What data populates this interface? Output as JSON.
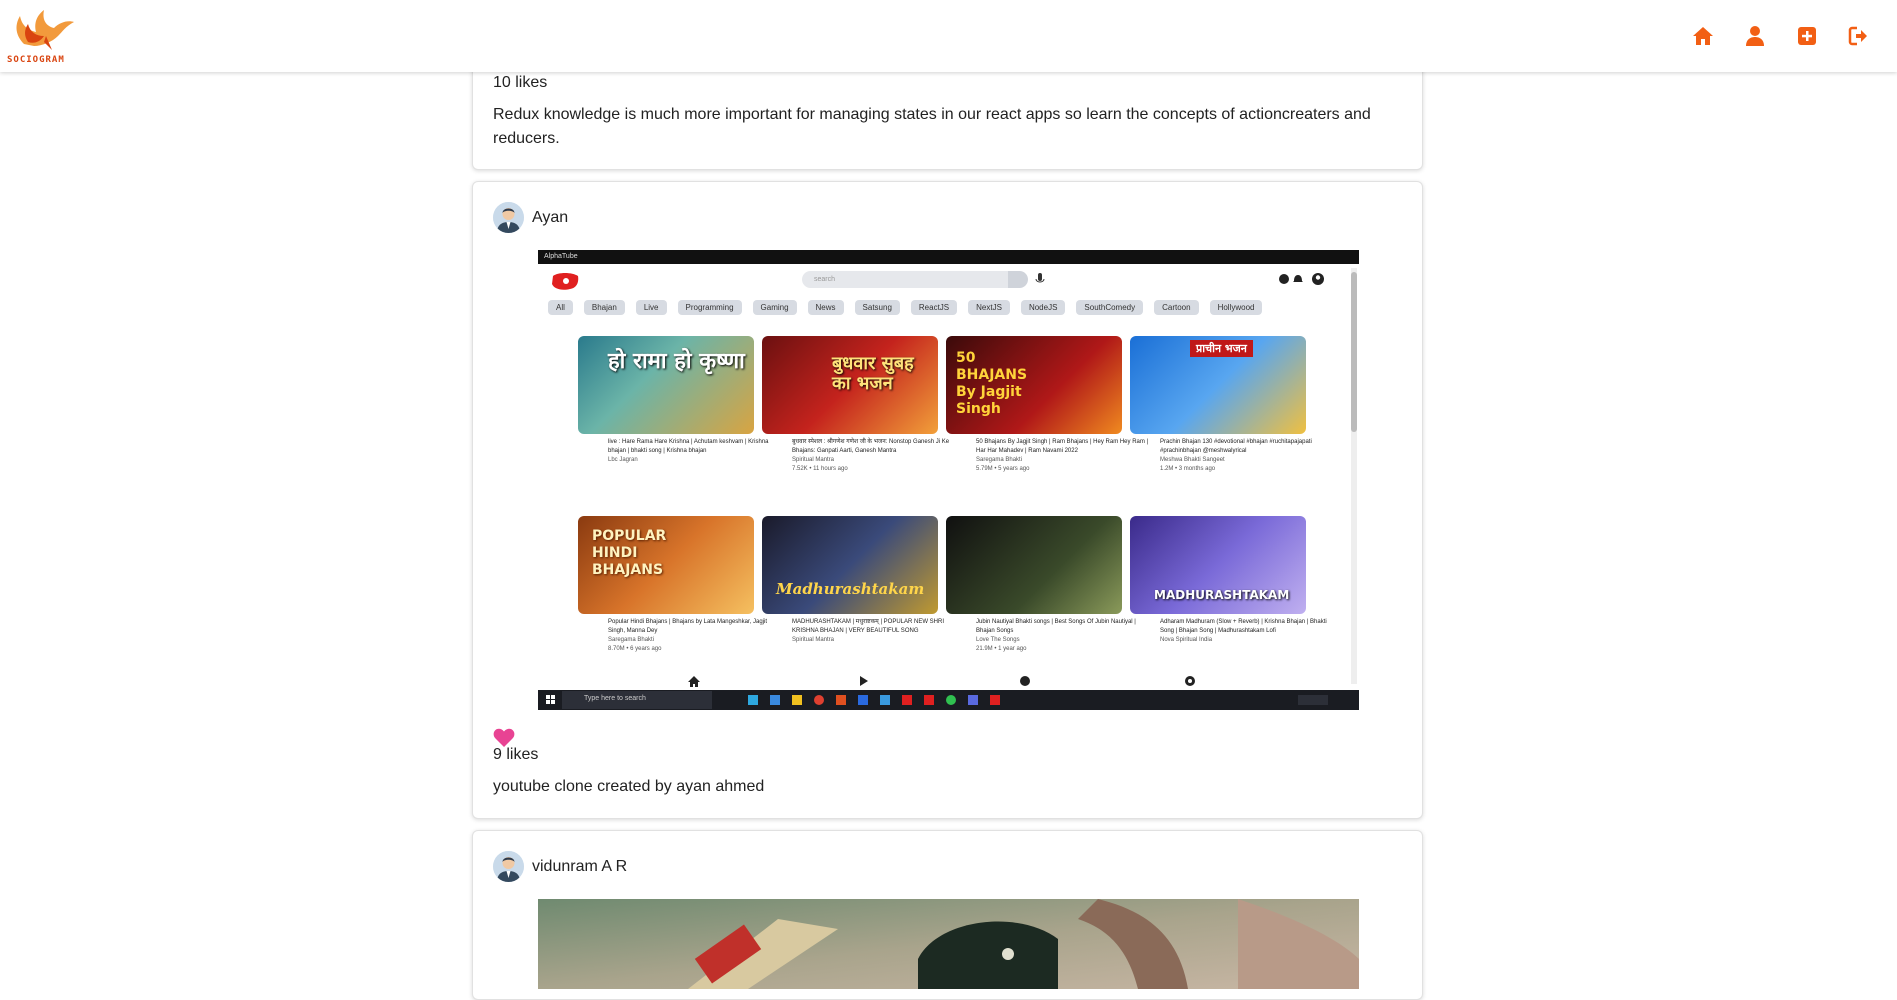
{
  "app": {
    "brand": "SOCIOGRAM",
    "colors": {
      "accent": "#f25f14",
      "heart": "#e84393"
    },
    "nav_icons": [
      "home-icon",
      "profile-icon",
      "add-post-icon",
      "logout-icon"
    ]
  },
  "posts": [
    {
      "likes": "10 likes",
      "caption": "Redux knowledge is much more important for managing states in our react apps so learn the concepts of actioncreaters and reducers."
    },
    {
      "user": "Ayan",
      "likes": "9 likes",
      "caption": "youtube clone created by ayan ahmed",
      "screenshot": {
        "window_title": "AlphaTube",
        "search_placeholder": "search",
        "chips": [
          "All",
          "Bhajan",
          "Live",
          "Programming",
          "Gaming",
          "News",
          "Satsung",
          "ReactJS",
          "NextJS",
          "NodeJS",
          "SouthComedy",
          "Cartoon",
          "Hollywood"
        ],
        "videos": [
          {
            "title": "live : Hare Rama Hare Krishna | Achutam keshvam | Krishna bhajan | bhakti song | Krishna bhajan",
            "channel": "Lbc Jagran",
            "stats": ""
          },
          {
            "title": "बुधवार स्पेशल : श्रीगणेश गणेश जी के भजन: Nonstop Ganesh Ji Ke Bhajans: Ganpati Aarti, Ganesh Mantra",
            "channel": "Spiritual Mantra",
            "stats": "7.52K • 11 hours ago"
          },
          {
            "title": "50 Bhajans By Jagjit Singh | Ram Bhajans | Hey Ram Hey Ram | Har Har Mahadev | Ram Navami 2022",
            "channel": "Saregama Bhakti",
            "stats": "5.79M • 5 years ago"
          },
          {
            "title": "Prachin Bhajan 130 #devotional #bhajan #ruchitapajapati #prachinbhajan @meshwalyrical",
            "channel": "Meshwa Bhakti Sangeet",
            "stats": "1.2M • 3 months ago"
          },
          {
            "title": "Popular Hindi Bhajans | Bhajans by Lata Mangeshkar, Jagjit Singh, Manna Dey",
            "channel": "Saregama Bhakti",
            "stats": "8.70M • 6 years ago"
          },
          {
            "title": "MADHURASHTAKAM | मधुराष्टकम् | POPULAR NEW SHRI KRISHNA BHAJAN | VERY BEAUTIFUL SONG",
            "channel": "Spiritual Mantra",
            "stats": ""
          },
          {
            "title": "Jubin Nautiyal Bhakti songs | Best Songs Of Jubin Nautiyal | Bhajan Songs",
            "channel": "Love The Songs",
            "stats": "21.9M • 1 year ago"
          },
          {
            "title": "Adharam Madhuram (Slow + Reverb) | Krishna Bhajan | Bhakti Song | Bhajan Song | Madhurashtakam Lofi",
            "channel": "Nova Spiritual India",
            "stats": ""
          }
        ],
        "thumb_texts": [
          "हो रामा हो कृष्णा",
          "बुधवार सुबह का भजन",
          "50 BHAJANS By Jagjit Singh",
          "प्राचीन भजन",
          "POPULAR HINDI BHAJANS",
          "Madhurashtakam",
          "",
          "MADHURASHTAKAM"
        ],
        "taskbar_search": "Type here to search"
      }
    },
    {
      "user": "vidunram A R"
    }
  ]
}
